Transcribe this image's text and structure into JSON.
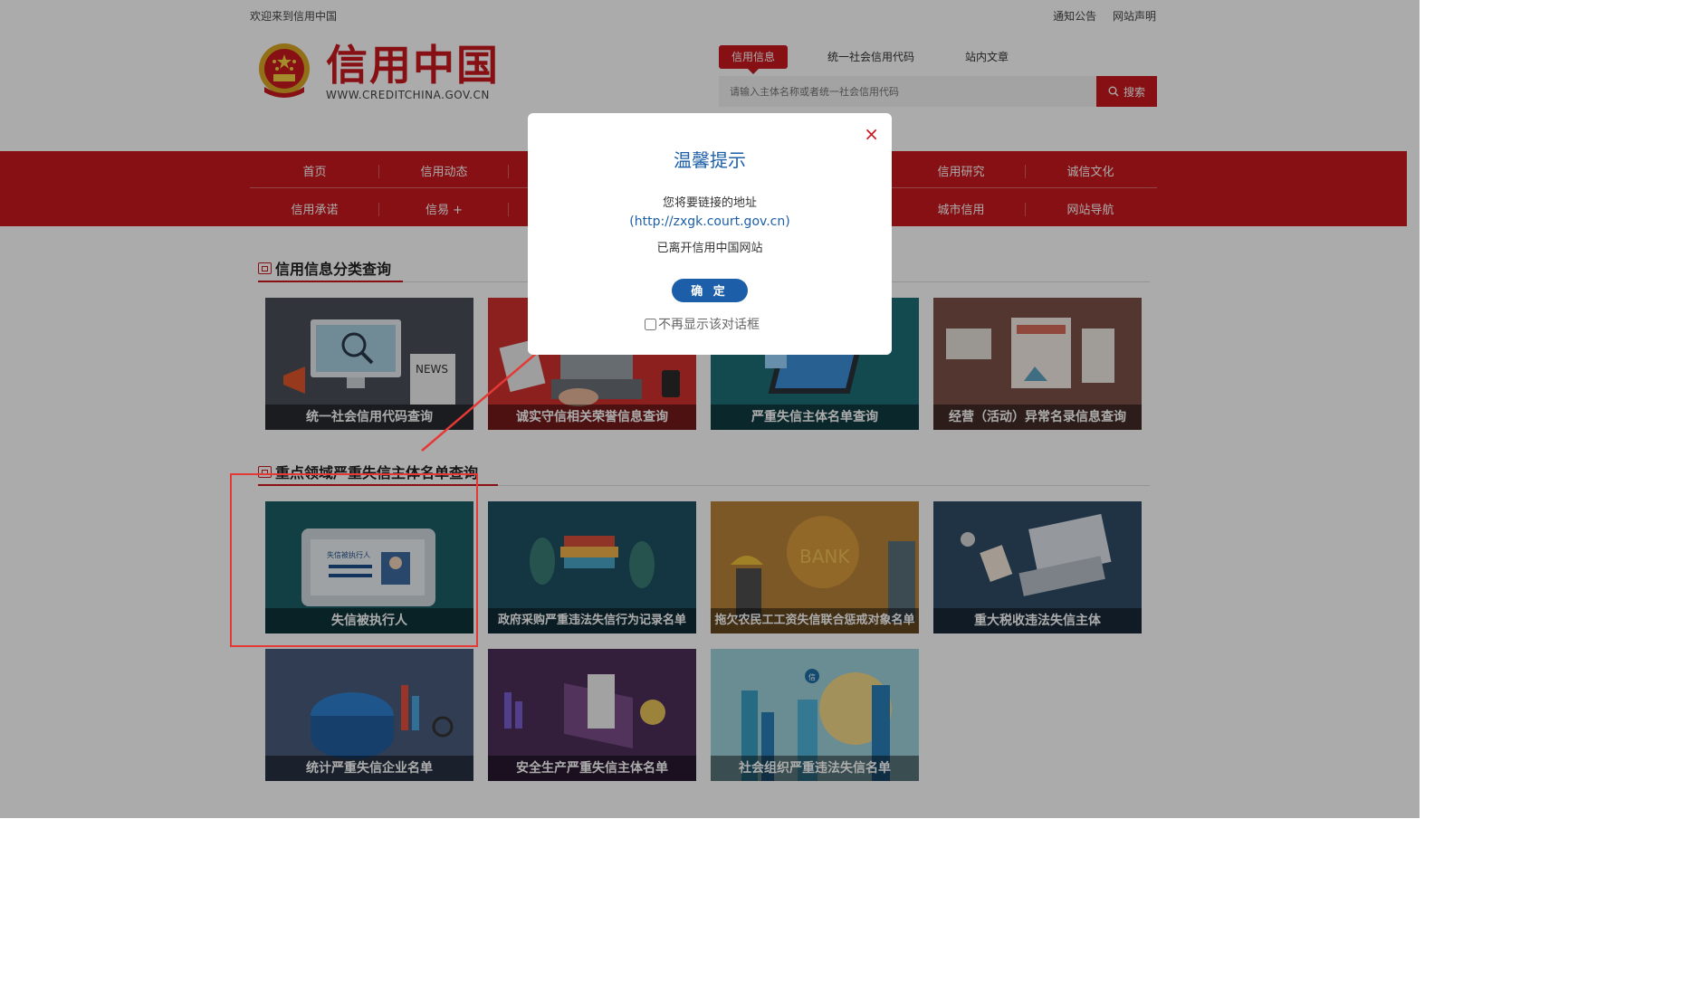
{
  "topbar": {
    "welcome": "欢迎来到信用中国",
    "links": [
      "通知公告",
      "网站声明"
    ]
  },
  "header": {
    "logo_title": "信用中国",
    "logo_url": "WWW.CREDITCHINA.GOV.CN",
    "search_tabs": [
      "信用信息",
      "统一社会信用代码",
      "站内文章"
    ],
    "search_placeholder": "请输入主体名称或者统一社会信用代码",
    "search_button": "搜索"
  },
  "nav": {
    "row1": [
      "首页",
      "信用动态",
      "",
      "",
      "",
      "信用研究",
      "诚信文化"
    ],
    "row2": [
      "信用承诺",
      "信易 +",
      "",
      "",
      "",
      "城市信用",
      "网站导航"
    ]
  },
  "sections": [
    {
      "title": "信用信息分类查询",
      "cards": [
        "统一社会信用代码查询",
        "诚实守信相关荣誉信息查询",
        "严重失信主体名单查询",
        "经营（活动）异常名录信息查询"
      ]
    },
    {
      "title": "重点领域严重失信主体名单查询",
      "cards": [
        "失信被执行人",
        "政府采购严重违法失信行为记录名单",
        "拖欠农民工工资失信联合惩戒对象名单",
        "重大税收违法失信主体",
        "统计严重失信企业名单",
        "安全生产严重失信主体名单",
        "社会组织严重违法失信名单"
      ]
    }
  ],
  "card_art_text": {
    "news": "NEWS",
    "bank": "BANK",
    "id_card": "失信被执行人",
    "badge": "信"
  },
  "dialog": {
    "title": "温馨提示",
    "line1": "您将要链接的地址",
    "url": "(http://zxgk.court.gov.cn)",
    "line2": "已离开信用中国网站",
    "confirm": "确 定",
    "dont_show": "不再显示该对话框",
    "close": "×"
  },
  "colors": {
    "brand_red": "#c8191e",
    "dialog_blue": "#1c5fa8",
    "annotation_red": "#e53935"
  }
}
